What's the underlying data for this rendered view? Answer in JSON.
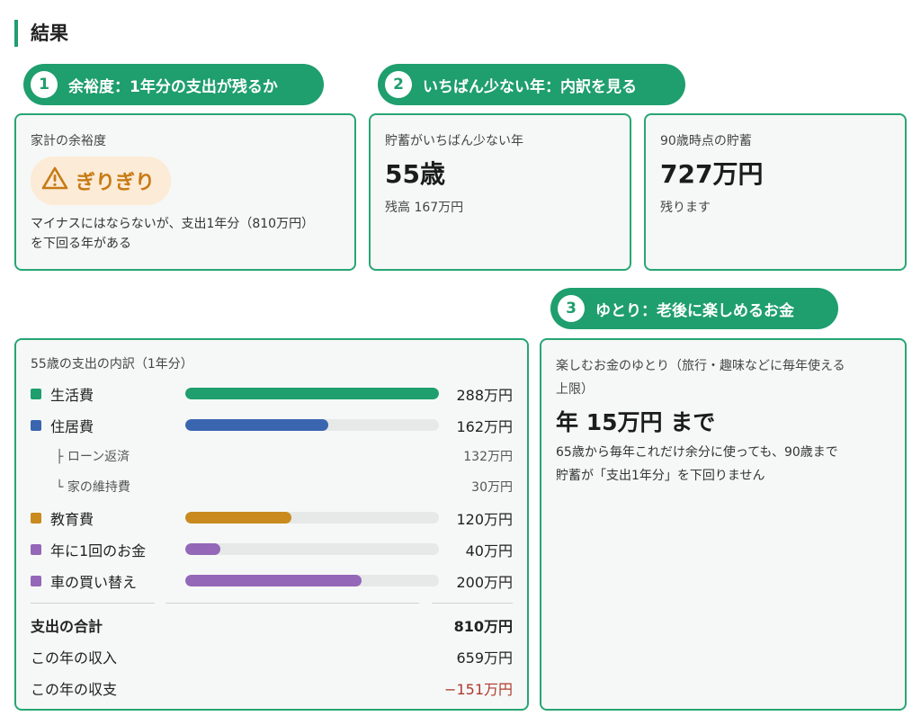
{
  "section_title": "結果",
  "steps": [
    {
      "num": "1",
      "label": "余裕度：1年分の支出が残るか"
    },
    {
      "num": "2",
      "label": "いちばん少ない年：内訳を見る"
    },
    {
      "num": "3",
      "label": "ゆとり：老後に楽しめるお金"
    }
  ],
  "margin_card": {
    "label": "家計の余裕度",
    "badge_icon": "warning-icon",
    "badge_text": "ぎりぎり",
    "badge_color": "#c77a14",
    "note_line1": "マイナスにはならないが、支出1年分（810万円）",
    "note_line2": "を下回る年がある"
  },
  "lowest_card": {
    "label": "貯蓄がいちばん少ない年",
    "value": "55歳",
    "sub": "残高 167万円"
  },
  "age90_card": {
    "label": "90歳時点の貯蓄",
    "value": "727万円",
    "sub": "残ります"
  },
  "breakdown": {
    "title": "55歳の支出の内訳（1年分）",
    "items": [
      {
        "label": "生活費",
        "amount": "288万円",
        "fraction": 1.0,
        "color": "#1f9e6e"
      },
      {
        "label": "住居費",
        "amount": "162万円",
        "fraction": 0.5625,
        "color": "#3a66b0"
      },
      {
        "label": "├ ローン返済",
        "amount": "132万円",
        "sub": true
      },
      {
        "label": "└ 家の維持費",
        "amount": "30万円",
        "sub": true
      },
      {
        "label": "教育費",
        "amount": "120万円",
        "fraction": 0.4167,
        "color": "#c98a1e"
      },
      {
        "label": "年に1回のお金",
        "amount": "40万円",
        "fraction": 0.139,
        "color": "#9467b8"
      },
      {
        "label": "車の買い替え",
        "amount": "200万円",
        "fraction": 0.694,
        "color": "#9467b8"
      }
    ],
    "total_label": "支出の合計",
    "total_amount": "810万円",
    "income_label": "この年の収入",
    "income_amount": "659万円",
    "balance_label": "この年の収支",
    "balance_amount": "−151万円",
    "negative_color": "#b03a2e"
  },
  "yutori_card": {
    "label_line1": "楽しむお金のゆとり（旅行・趣味などに毎年使える",
    "label_line2": "上限）",
    "value": "年 15万円 まで",
    "note_line1": "65歳から毎年これだけ余分に使っても、90歳まで",
    "note_line2": "貯蓄が「支出1年分」を下回りません"
  }
}
